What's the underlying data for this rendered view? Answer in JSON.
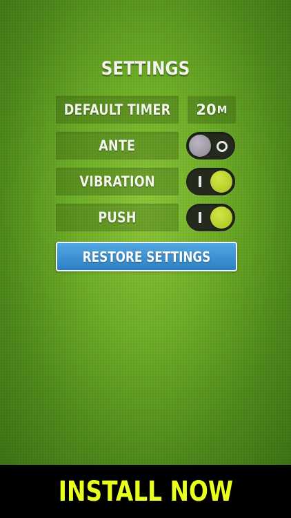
{
  "settings": {
    "title": "SETTINGS",
    "default_timer": {
      "label": "DEFAULT TIMER",
      "value": "20",
      "unit": "M"
    },
    "ante": {
      "label": "ANTE",
      "state": "off"
    },
    "vibration": {
      "label": "VIBRATION",
      "state": "on"
    },
    "push": {
      "label": "PUSH",
      "state": "on"
    },
    "restore_label": "RESTORE SETTINGS"
  },
  "banner": {
    "label": "INSTALL NOW"
  },
  "colors": {
    "background_green": "#6fae28",
    "toggle_on": "#b9d32c",
    "toggle_off": "#a59fab",
    "restore_button": "#3a8fd2",
    "install_text": "#e9ff1e"
  }
}
